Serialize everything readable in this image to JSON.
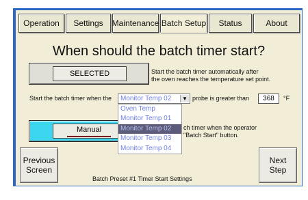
{
  "tabs": [
    {
      "label": "Operation"
    },
    {
      "label": "Settings"
    },
    {
      "label": "Maintenance"
    },
    {
      "label": "Batch Setup"
    },
    {
      "label": "Status"
    },
    {
      "label": "About"
    }
  ],
  "active_tab": "Batch Setup",
  "page_title": "When should the batch timer start?",
  "option1": {
    "button_label": "SELECTED",
    "description_line1": "Start the batch timer automatically after",
    "description_line2": "the oven reaches the temperature set point."
  },
  "condition": {
    "prefix": "Start the batch timer when the",
    "probe_selected": "Monitor Temp 02",
    "suffix": "probe is greater than",
    "temperature": "368",
    "unit": "°F",
    "dropdown_options": [
      "Oven Temp",
      "Monitor Temp 01",
      "Monitor Temp 02",
      "Monitor Temp 03",
      "Monitor Temp 04"
    ]
  },
  "option2": {
    "button_label": "Manual",
    "description_line1": "ch timer when the operator",
    "description_line2": "\"Batch Start\" button."
  },
  "nav": {
    "previous_line1": "Previous",
    "previous_line2": "Screen",
    "next_line1": "Next",
    "next_line2": "Step"
  },
  "footer": "Batch Preset #1 Timer Start Settings",
  "colors": {
    "frame": "#2d67c5",
    "panel": "#f1edd6",
    "manual_button": "#3dd6f0",
    "dropdown_text": "#6f7fe0"
  }
}
